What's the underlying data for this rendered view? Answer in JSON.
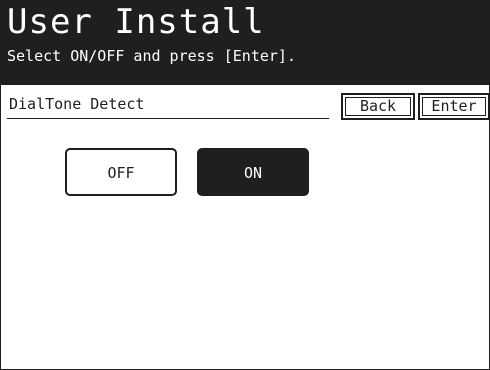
{
  "screen": {
    "title": "User Install",
    "subtitle": "Select ON/OFF and press [Enter]."
  },
  "setting": {
    "label": "DialTone Detect",
    "selected": "ON"
  },
  "buttons": {
    "back": "Back",
    "enter": "Enter",
    "off": "OFF",
    "on": "ON"
  },
  "colors": {
    "dark": "#1f1f1f",
    "light": "#ffffff"
  }
}
